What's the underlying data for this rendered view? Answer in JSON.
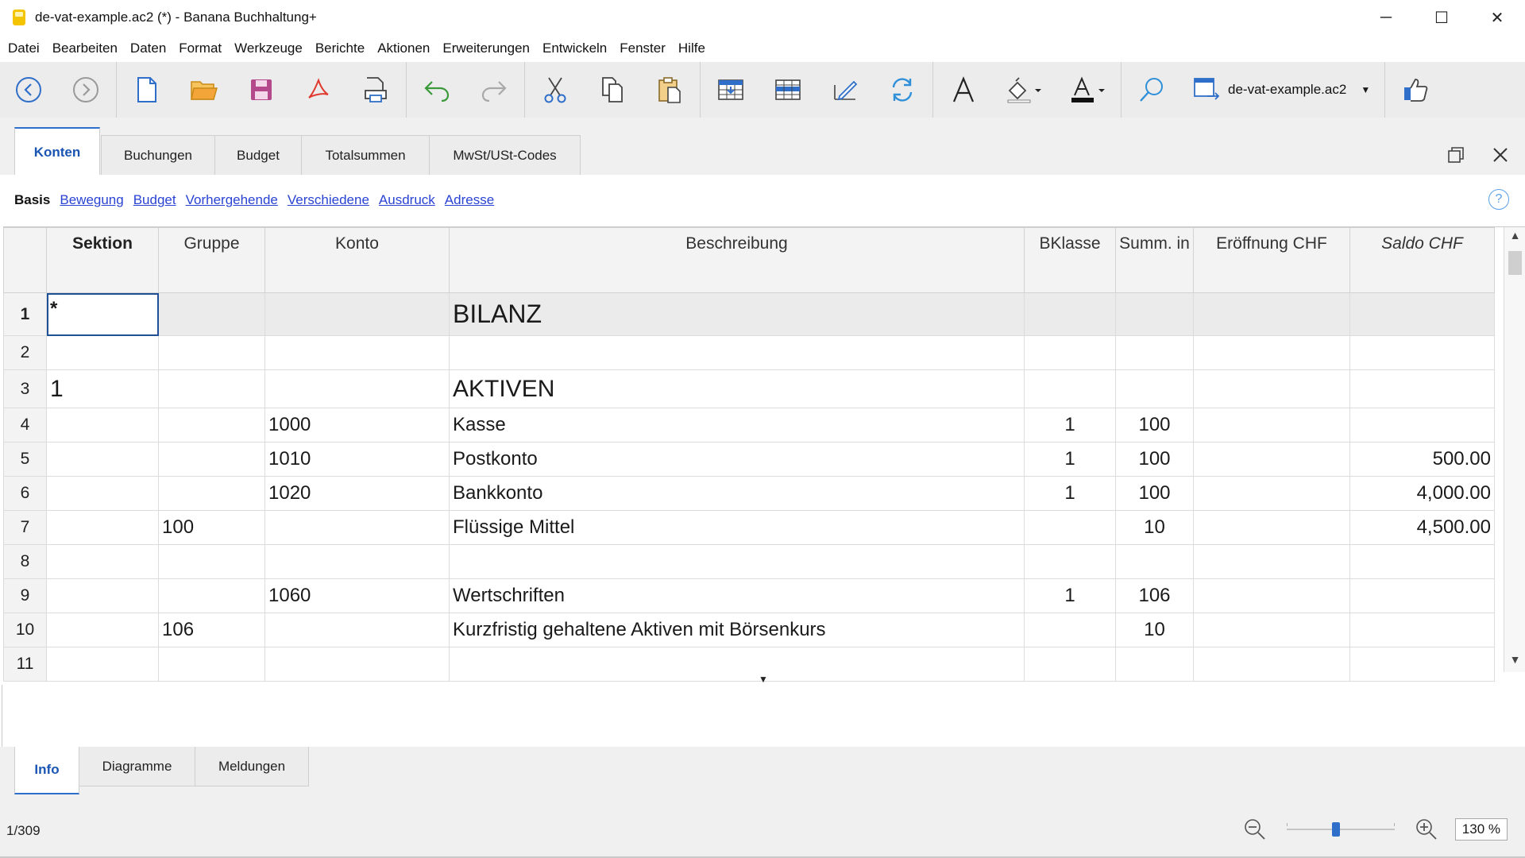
{
  "window": {
    "title": "de-vat-example.ac2 (*) - Banana Buchhaltung+",
    "minimize_glyph": "─",
    "maximize_glyph": "☐",
    "close_glyph": "✕"
  },
  "menu": [
    "Datei",
    "Bearbeiten",
    "Daten",
    "Format",
    "Werkzeuge",
    "Berichte",
    "Aktionen",
    "Erweiterungen",
    "Entwickeln",
    "Fenster",
    "Hilfe"
  ],
  "toolbar": {
    "buttons": [
      {
        "name": "back-icon"
      },
      {
        "name": "forward-icon"
      },
      {
        "name": "new-file-icon"
      },
      {
        "name": "open-folder-icon"
      },
      {
        "name": "save-icon"
      },
      {
        "name": "pdf-icon"
      },
      {
        "name": "print-icon"
      },
      {
        "name": "undo-icon"
      },
      {
        "name": "redo-icon"
      },
      {
        "name": "cut-icon"
      },
      {
        "name": "copy-icon"
      },
      {
        "name": "paste-icon"
      },
      {
        "name": "insert-rows-icon"
      },
      {
        "name": "move-rows-icon"
      },
      {
        "name": "edit-icon"
      },
      {
        "name": "recalculate-icon"
      },
      {
        "name": "font-icon"
      },
      {
        "name": "fill-color-icon"
      },
      {
        "name": "text-color-icon"
      },
      {
        "name": "search-icon"
      }
    ],
    "file_selector": "de-vat-example.ac2",
    "accent": "#2f6fc9"
  },
  "doc_tabs": [
    "Konten",
    "Buchungen",
    "Budget",
    "Totalsummen",
    "MwSt/USt-Codes"
  ],
  "views": {
    "active": "Basis",
    "links": [
      "Bewegung",
      "Budget",
      "Vorhergehende",
      "Verschiedene",
      "Ausdruck",
      "Adresse"
    ],
    "help": "?"
  },
  "table": {
    "columns": [
      "Sektion",
      "Gruppe",
      "Konto",
      "Beschreibung",
      "BKlasse",
      "Summ. in",
      "Eröffnung CHF",
      "Saldo CHF"
    ],
    "rows": [
      {
        "n": "1",
        "sektion": "*",
        "gruppe": "",
        "konto": "",
        "beschreibung": "BILANZ",
        "bklasse": "",
        "summ": "",
        "eroeffnung": "",
        "saldo": ""
      },
      {
        "n": "2",
        "sektion": "",
        "gruppe": "",
        "konto": "",
        "beschreibung": "",
        "bklasse": "",
        "summ": "",
        "eroeffnung": "",
        "saldo": ""
      },
      {
        "n": "3",
        "sektion": "1",
        "gruppe": "",
        "konto": "",
        "beschreibung": "AKTIVEN",
        "bklasse": "",
        "summ": "",
        "eroeffnung": "",
        "saldo": ""
      },
      {
        "n": "4",
        "sektion": "",
        "gruppe": "",
        "konto": "1000",
        "beschreibung": "Kasse",
        "bklasse": "1",
        "summ": "100",
        "eroeffnung": "",
        "saldo": ""
      },
      {
        "n": "5",
        "sektion": "",
        "gruppe": "",
        "konto": "1010",
        "beschreibung": "Postkonto",
        "bklasse": "1",
        "summ": "100",
        "eroeffnung": "",
        "saldo": "500.00"
      },
      {
        "n": "6",
        "sektion": "",
        "gruppe": "",
        "konto": "1020",
        "beschreibung": "Bankkonto",
        "bklasse": "1",
        "summ": "100",
        "eroeffnung": "",
        "saldo": "4,000.00"
      },
      {
        "n": "7",
        "sektion": "",
        "gruppe": "100",
        "konto": "",
        "beschreibung": "Flüssige Mittel",
        "bklasse": "",
        "summ": "10",
        "eroeffnung": "",
        "saldo": "4,500.00"
      },
      {
        "n": "8",
        "sektion": "",
        "gruppe": "",
        "konto": "",
        "beschreibung": "",
        "bklasse": "",
        "summ": "",
        "eroeffnung": "",
        "saldo": ""
      },
      {
        "n": "9",
        "sektion": "",
        "gruppe": "",
        "konto": "1060",
        "beschreibung": "Wertschriften",
        "bklasse": "1",
        "summ": "106",
        "eroeffnung": "",
        "saldo": ""
      },
      {
        "n": "10",
        "sektion": "",
        "gruppe": "106",
        "konto": "",
        "beschreibung": "Kurzfristig gehaltene Aktiven mit Börsenkurs",
        "bklasse": "",
        "summ": "10",
        "eroeffnung": "",
        "saldo": ""
      },
      {
        "n": "11",
        "sektion": "",
        "gruppe": "",
        "konto": "",
        "beschreibung": "",
        "bklasse": "",
        "summ": "",
        "eroeffnung": "",
        "saldo": ""
      }
    ]
  },
  "info_tabs": [
    "Info",
    "Diagramme",
    "Meldungen"
  ],
  "status": {
    "position": "1/309",
    "zoom": "130 %",
    "zoom_slider_level": 0.45
  }
}
